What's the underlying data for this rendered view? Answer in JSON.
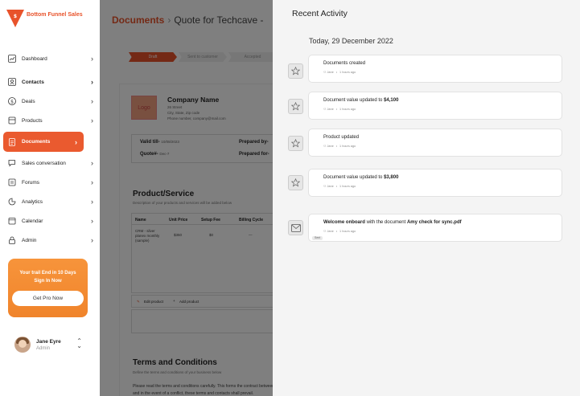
{
  "brand": {
    "name": "Bottom Funnel Sales",
    "accent": "#e8532b"
  },
  "sidebar": {
    "items": [
      {
        "label": "Dashboard",
        "icon": "chart-line-icon",
        "active": false
      },
      {
        "label": "Contacts",
        "icon": "contacts-icon",
        "active": false
      },
      {
        "label": "Deals",
        "icon": "dollar-icon",
        "active": false
      },
      {
        "label": "Products",
        "icon": "box-icon",
        "active": false
      },
      {
        "label": "Documents",
        "icon": "document-icon",
        "active": true
      },
      {
        "label": "Sales conversation",
        "icon": "chat-icon",
        "active": false
      },
      {
        "label": "Forums",
        "icon": "forum-icon",
        "active": false
      },
      {
        "label": "Analytics",
        "icon": "analytics-icon",
        "active": false
      },
      {
        "label": "Calendar",
        "icon": "calendar-icon",
        "active": false
      },
      {
        "label": "Admin",
        "icon": "lock-icon",
        "active": false
      }
    ],
    "trial": {
      "line1": "Your trail End in 10 Days",
      "line2": "Sign In Now",
      "button": "Get Pro Now"
    },
    "user": {
      "name": "Jane Eyre",
      "role": "Admin"
    }
  },
  "main": {
    "breadcrumb": {
      "root": "Documents",
      "separator": "›",
      "current": "Quote for Techcave -"
    },
    "steps": [
      "Draft",
      "Sent to customer",
      "Accepted"
    ],
    "doc": {
      "logo": "Logo",
      "company": "Company Name",
      "address": [
        "26 Street",
        "City, State, Zip code",
        "Phone number, company@mail.com"
      ],
      "valid_till_label": "Valid till-",
      "valid_till": "10/08/2023",
      "quote_label": "Quote#-",
      "quote": "Dec-7",
      "prepared_by_label": "Prepared by-",
      "prepared_for_label": "Prepared for-",
      "product_title": "Product/Service",
      "product_sub": "Description of your products and services will be added below",
      "table_headers": [
        "Name",
        "Unit Price",
        "Setup Fee",
        "Billing Cycle"
      ],
      "row": {
        "name": "CRM - silver planex monthly (sample)",
        "unit_price": "$350",
        "setup_fee": "$0",
        "billing": "—"
      },
      "edit_product": "Edit product",
      "add_product": "Add product",
      "terms_title": "Terms and Conditions",
      "terms_sub": "Define the terms and conditions of your business below",
      "terms_text": "Please read the terms and conditions carefully. This forms the contract between and in the event of a conflict, these terms and contacts shall prevail."
    }
  },
  "activity": {
    "title": "Recent Activity",
    "date": "Today, 29 December 2022",
    "items": [
      {
        "icon": "star-icon",
        "title": "Documents created",
        "amount": "",
        "by": "Jane",
        "time": "1 hours ago"
      },
      {
        "icon": "star-icon",
        "title": "Document value updated to ",
        "amount": "$4,100",
        "by": "Jane",
        "time": "1 hours ago"
      },
      {
        "icon": "star-icon",
        "title": "Product updated",
        "amount": "",
        "by": "Jane",
        "time": "1 hours ago"
      },
      {
        "icon": "star-icon",
        "title": "Document value updated to ",
        "amount": "$3,800",
        "by": "Jane",
        "time": "1 hours ago"
      }
    ],
    "email": {
      "icon": "mail-icon",
      "bold": "Welcome onboard",
      "middle": " with the document ",
      "file": "Amy check for sync.pdf",
      "by": "Jane",
      "time": "1 hours ago",
      "tag": "Sent"
    }
  }
}
